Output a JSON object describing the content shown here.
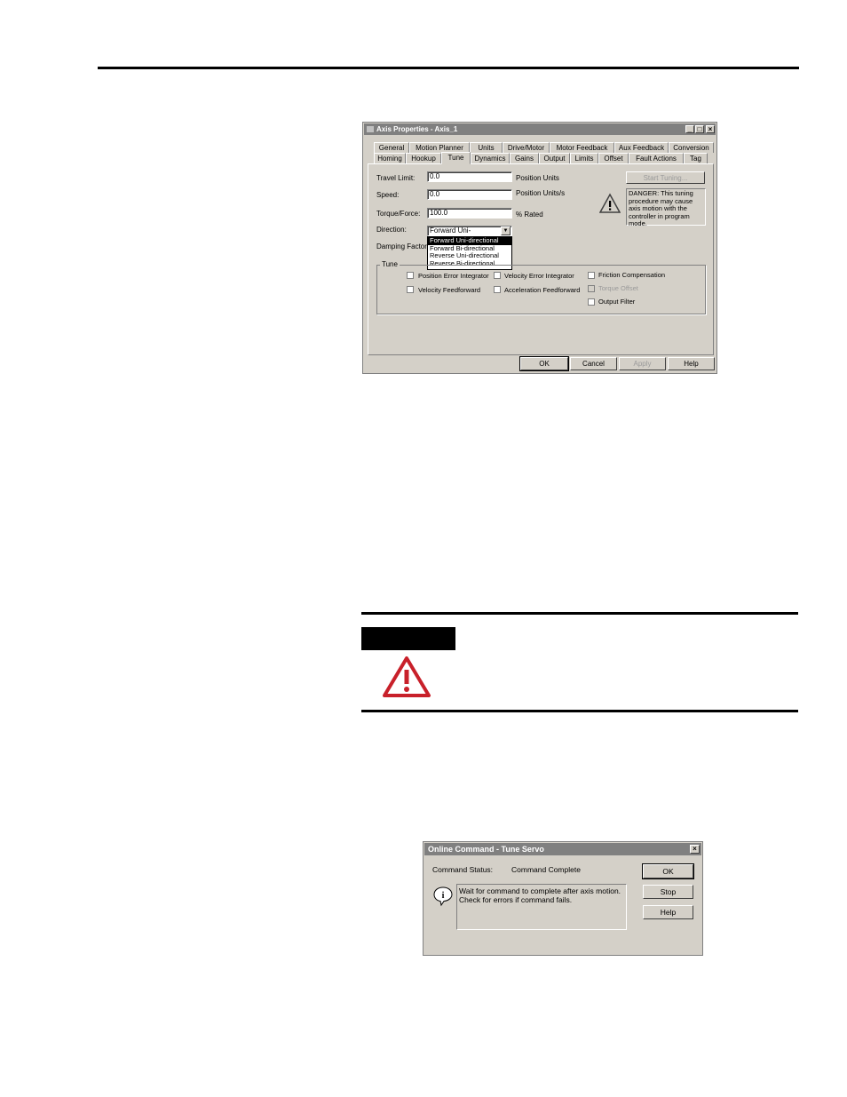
{
  "axis_dialog": {
    "title": "Axis Properties - Axis_1",
    "tabs_row1": [
      "General",
      "Motion Planner",
      "Units",
      "Drive/Motor",
      "Motor Feedback",
      "Aux Feedback",
      "Conversion"
    ],
    "tabs_row2": [
      "Homing",
      "Hookup",
      "Tune",
      "Dynamics",
      "Gains",
      "Output",
      "Limits",
      "Offset",
      "Fault Actions",
      "Tag"
    ],
    "active_tab": "Tune",
    "travel_limit_label": "Travel Limit:",
    "travel_limit_value": "0.0",
    "travel_limit_unit": "Position Units",
    "speed_label": "Speed:",
    "speed_value": "0.0",
    "speed_unit": "Position Units/s",
    "torque_label": "Torque/Force:",
    "torque_value": "100.0",
    "torque_unit": "% Rated",
    "direction_label": "Direction:",
    "direction_value": "Forward Uni-directional",
    "direction_options": [
      "Forward Uni-directional",
      "Forward Bi-directional",
      "Reverse Uni-directional",
      "Reverse Bi-directional"
    ],
    "damping_label": "Damping Factor:",
    "start_tuning_label": "Start Tuning...",
    "danger_text": "DANGER: This tuning procedure may cause axis motion with the controller in program mode.",
    "tune_group_label": "Tune",
    "checkboxes": {
      "position_error_integrator": "Position Error Integrator",
      "velocity_error_integrator": "Velocity Error Integrator",
      "friction_compensation": "Friction Compensation",
      "velocity_feedforward": "Velocity Feedforward",
      "acceleration_feedforward": "Acceleration Feedforward",
      "torque_offset": "Torque Offset",
      "output_filter": "Output Filter"
    },
    "ok_label": "OK",
    "cancel_label": "Cancel",
    "apply_label": "Apply",
    "help_label": "Help",
    "min_glyph": "_",
    "max_glyph": "□",
    "close_glyph": "×",
    "dropdown_arrow": "▼"
  },
  "online_dialog": {
    "title": "Online Command - Tune Servo",
    "status_label": "Command Status:",
    "status_value": "Command Complete",
    "message": "Wait for command to complete after axis motion. Check for errors if command fails.",
    "ok_label": "OK",
    "stop_label": "Stop",
    "help_label": "Help",
    "close_glyph": "×",
    "info_glyph": "i"
  },
  "colors": {
    "warning_red": "#c8202a",
    "dialog_gray": "#d4d0c8"
  }
}
